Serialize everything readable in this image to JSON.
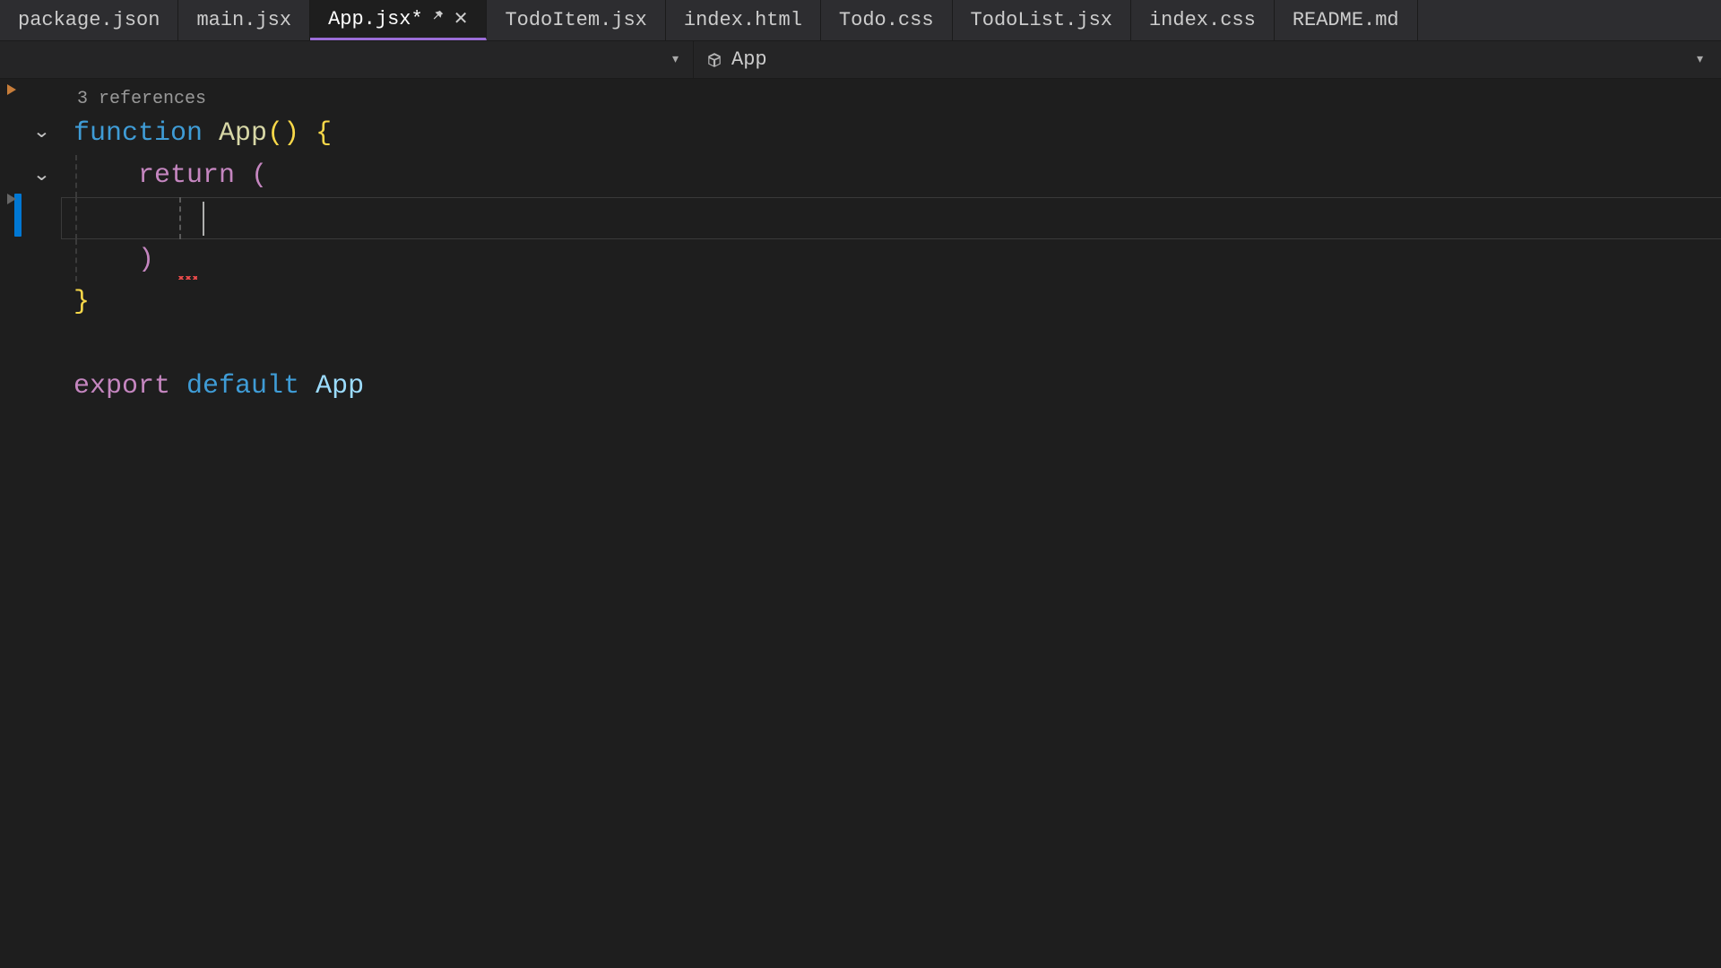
{
  "tabs": [
    {
      "label": "package.json",
      "active": false,
      "modified": false
    },
    {
      "label": "main.jsx",
      "active": false,
      "modified": false
    },
    {
      "label": "App.jsx*",
      "active": true,
      "modified": true
    },
    {
      "label": "TodoItem.jsx",
      "active": false,
      "modified": false
    },
    {
      "label": "index.html",
      "active": false,
      "modified": false
    },
    {
      "label": "Todo.css",
      "active": false,
      "modified": false
    },
    {
      "label": "TodoList.jsx",
      "active": false,
      "modified": false
    },
    {
      "label": "index.css",
      "active": false,
      "modified": false
    },
    {
      "label": "README.md",
      "active": false,
      "modified": false
    }
  ],
  "breadcrumb": {
    "symbol": "App"
  },
  "codelens": {
    "references": "3 references"
  },
  "code": {
    "l1_function": "function",
    "l1_name": "App",
    "l1_parens": "()",
    "l1_brace": "{",
    "l2_return": "return",
    "l2_paren": "(",
    "l4_paren": ")",
    "l5_brace": "}",
    "l7_export": "export",
    "l7_default": "default",
    "l7_ident": "App"
  }
}
